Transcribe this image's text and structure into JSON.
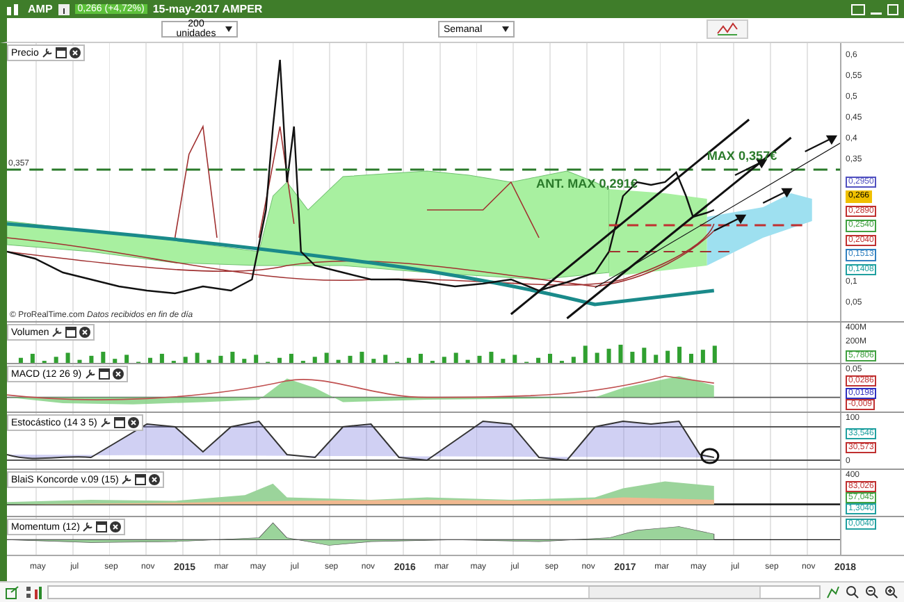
{
  "title_bar": {
    "symbol": "AMP",
    "quote": "0,266 (+4,72%)",
    "date_name": "15-may-2017 AMPER"
  },
  "toolbar": {
    "units": "200 unidades",
    "period": "Semanal"
  },
  "price_panel": {
    "title": "Precio",
    "left_level": "0,357",
    "annotations": [
      "ANT. MAX 0,291€",
      "MAX 0,357€"
    ],
    "footer": "© ProRealTime.com  *Datos recibidos en fin de día*",
    "axis": [
      {
        "text": "0,6",
        "kind": "tick"
      },
      {
        "text": "0,55",
        "kind": "tick"
      },
      {
        "text": "0,5",
        "kind": "tick"
      },
      {
        "text": "0,45",
        "kind": "tick"
      },
      {
        "text": "0,4",
        "kind": "tick"
      },
      {
        "text": "0,35",
        "kind": "tick"
      },
      {
        "text": "0,2950",
        "kind": "value",
        "color": "#5050c0"
      },
      {
        "text": "0,266",
        "kind": "value",
        "color": "#f0c000"
      },
      {
        "text": "0,2890",
        "kind": "value",
        "color": "#c03030"
      },
      {
        "text": "0,2540",
        "kind": "value",
        "color": "#40a040"
      },
      {
        "text": "0,2040",
        "kind": "value",
        "color": "#c03030"
      },
      {
        "text": "0,1513",
        "kind": "value",
        "color": "#3080c0"
      },
      {
        "text": "0,1408",
        "kind": "value",
        "color": "#20a0a0"
      },
      {
        "text": "0,1",
        "kind": "tick"
      },
      {
        "text": "0,05",
        "kind": "tick"
      }
    ]
  },
  "indicators": [
    {
      "kind": "volume",
      "title": "Volumen",
      "axis": [
        {
          "text": "400M",
          "kind": "tick"
        },
        {
          "text": "200M",
          "kind": "tick"
        },
        {
          "text": "5,7806",
          "kind": "value",
          "color": "#40a040"
        }
      ]
    },
    {
      "kind": "macd",
      "title": "MACD (12 26 9)",
      "axis": [
        {
          "text": "0,05",
          "kind": "tick"
        },
        {
          "text": "0,0286",
          "kind": "value",
          "color": "#c03030"
        },
        {
          "text": "0,0198",
          "kind": "value",
          "color": "#3030c0"
        },
        {
          "text": "-0,009",
          "kind": "value",
          "color": "#c03030"
        }
      ]
    },
    {
      "kind": "stochastic",
      "title": "Estocástico (14 3 5)",
      "axis": [
        {
          "text": "100",
          "kind": "tick"
        },
        {
          "text": "33,546",
          "kind": "value",
          "color": "#20a0a0"
        },
        {
          "text": "30,573",
          "kind": "value",
          "color": "#c03030"
        },
        {
          "text": "0",
          "kind": "tick"
        }
      ]
    },
    {
      "kind": "koncorde",
      "title": "BlaiS Koncorde v.09 (15)",
      "axis": [
        {
          "text": "400",
          "kind": "tick"
        },
        {
          "text": "83,026",
          "kind": "value",
          "color": "#c03030"
        },
        {
          "text": "57,045",
          "kind": "value",
          "color": "#40a040"
        },
        {
          "text": "1,3040",
          "kind": "value",
          "color": "#20a0a0"
        }
      ]
    },
    {
      "kind": "momentum",
      "title": "Momentum (12)",
      "axis": [
        {
          "text": "0,0040",
          "kind": "value",
          "color": "#20a0a0"
        }
      ]
    }
  ],
  "x_axis": [
    {
      "text": "may",
      "kind": "month"
    },
    {
      "text": "jul",
      "kind": "month"
    },
    {
      "text": "sep",
      "kind": "month"
    },
    {
      "text": "nov",
      "kind": "month"
    },
    {
      "text": "2015",
      "kind": "year"
    },
    {
      "text": "mar",
      "kind": "month"
    },
    {
      "text": "may",
      "kind": "month"
    },
    {
      "text": "jul",
      "kind": "month"
    },
    {
      "text": "sep",
      "kind": "month"
    },
    {
      "text": "nov",
      "kind": "month"
    },
    {
      "text": "2016",
      "kind": "year"
    },
    {
      "text": "mar",
      "kind": "month"
    },
    {
      "text": "may",
      "kind": "month"
    },
    {
      "text": "jul",
      "kind": "month"
    },
    {
      "text": "sep",
      "kind": "month"
    },
    {
      "text": "nov",
      "kind": "month"
    },
    {
      "text": "2017",
      "kind": "year"
    },
    {
      "text": "mar",
      "kind": "month"
    },
    {
      "text": "may",
      "kind": "month"
    },
    {
      "text": "jul",
      "kind": "month"
    },
    {
      "text": "sep",
      "kind": "month"
    },
    {
      "text": "nov",
      "kind": "month"
    },
    {
      "text": "2018",
      "kind": "year"
    }
  ]
}
